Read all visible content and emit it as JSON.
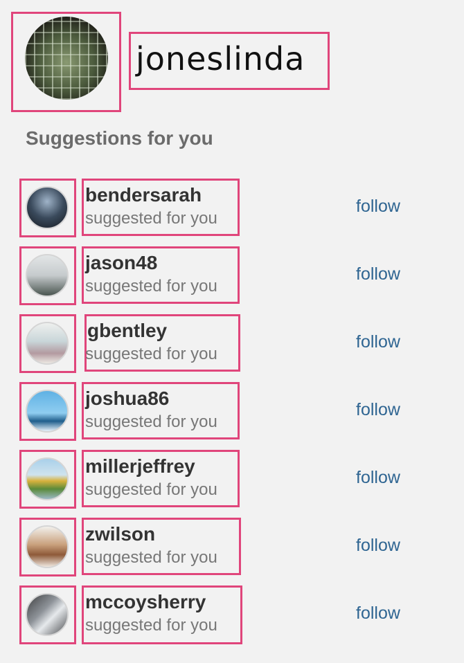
{
  "profile": {
    "username": "joneslinda",
    "avatar": "profile-avatar-photo"
  },
  "section_title": "Suggestions for you",
  "suggestions": [
    {
      "username": "bendersarah",
      "subtitle": "suggested for you",
      "action": "follow"
    },
    {
      "username": "jason48",
      "subtitle": "suggested for you",
      "action": "follow"
    },
    {
      "username": "gbentley",
      "subtitle": "suggested for you",
      "action": "follow"
    },
    {
      "username": "joshua86",
      "subtitle": "suggested for you",
      "action": "follow"
    },
    {
      "username": "millerjeffrey",
      "subtitle": "suggested for you",
      "action": "follow"
    },
    {
      "username": "zwilson",
      "subtitle": "suggested for you",
      "action": "follow"
    },
    {
      "username": "mccoysherry",
      "subtitle": "suggested for you",
      "action": "follow"
    }
  ],
  "colors": {
    "highlight": "#e0457b",
    "link": "#2f6592",
    "background": "#f2f2f2"
  }
}
